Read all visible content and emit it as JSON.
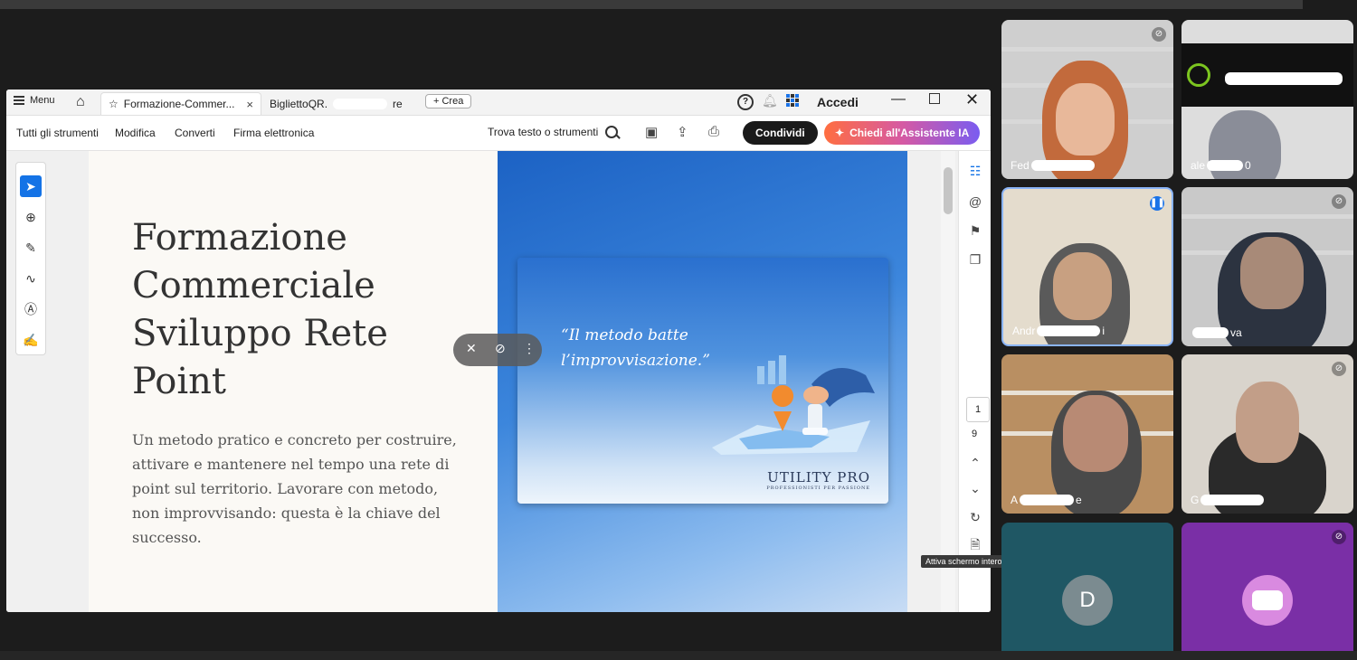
{
  "browser": {
    "menu_label": "Menu"
  },
  "tabs": [
    {
      "label": "Formazione-Commer...",
      "close": "×"
    },
    {
      "label": "BigliettoQR.",
      "suffix": "re"
    }
  ],
  "crea_label": "+ Crea",
  "help": "?",
  "accedi": "Accedi",
  "window": {
    "minimize": "—",
    "close": "✕"
  },
  "toolbar": {
    "items": [
      "Tutti gli strumenti",
      "Modifica",
      "Converti",
      "Firma elettronica"
    ],
    "find": "Trova testo o strumenti",
    "share": "Condividi",
    "ai": "Chiedi all'Assistente IA"
  },
  "slide": {
    "title": "Formazione Commerciale Sviluppo Rete Point",
    "body": "Un metodo pratico e concreto per costruire, attivare e mantenere nel tempo una rete di point sul territorio. Lavorare con metodo, non improvvisando: questa è la chiave del successo.",
    "quote": "“Il metodo batte l’improvvisazione.”",
    "logo": "UTILITY PRO",
    "logo_tag": "PROFESSIONISTI PER PASSIONE"
  },
  "page_nav": {
    "current": "1",
    "total": "9"
  },
  "tooltip": "Attiva schermo intero",
  "participants": [
    {
      "name": "Fed",
      "muted": true
    },
    {
      "name": "ale",
      "suffix": "0",
      "muted": false
    },
    {
      "name": "Andr",
      "suffix": "i",
      "speaking": true
    },
    {
      "name": "",
      "suffix": "va",
      "muted": true
    },
    {
      "name": "A",
      "suffix": "e",
      "muted": false
    },
    {
      "name": "G",
      "muted": true
    },
    {
      "name": "",
      "initial": "D"
    },
    {
      "name": "",
      "muted": true
    }
  ],
  "colors": {
    "accent": "#1473e6",
    "tile_teal": "#1f5764",
    "tile_purple": "#7a2fa6"
  }
}
